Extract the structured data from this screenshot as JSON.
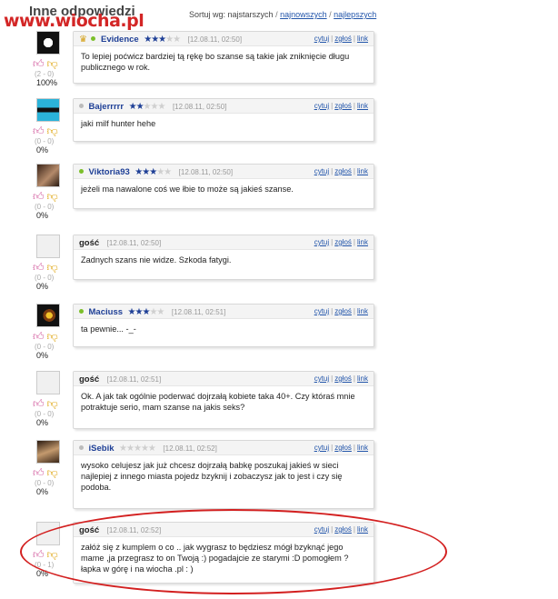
{
  "header": {
    "title": "Inne odpowiedzi",
    "watermark": "www.wiocha.pl",
    "sort_label": "Sortuj wg: najstarszych",
    "sort_separator": "/",
    "sort_newest": "najnowszych",
    "sort_best": "najlepszych"
  },
  "actions": {
    "quote": "cytuj",
    "report": "zgłoś",
    "link": "link",
    "sep": "|"
  },
  "comments": [
    {
      "user": "Evidence",
      "rating": 3,
      "date": "[12.08.11, 02:50]",
      "text": "To lepiej poćwicz bardziej tą rękę bo szanse są takie jak zniknięcie długu publicznego w rok.",
      "votes": "(2 - 0)",
      "percent": "100%",
      "status": "online"
    },
    {
      "user": "Bajerrrrr",
      "rating": 1.5,
      "date": "[12.08.11, 02:50]",
      "text": "jaki milf hunter hehe",
      "votes": "(0 - 0)",
      "percent": "0%",
      "status": "offline"
    },
    {
      "user": "Viktoria93",
      "rating": 3,
      "date": "[12.08.11, 02:50]",
      "text": "jeżeli ma nawalone coś we łbie to może są jakieś szanse.",
      "votes": "(0 - 0)",
      "percent": "0%",
      "status": "online"
    },
    {
      "user": "gość",
      "rating": 0,
      "date": "[12.08.11, 02:50]",
      "text": "Zadnych szans nie widze. Szkoda fatygi.",
      "votes": "(0 - 0)",
      "percent": "0%",
      "status": "guest"
    },
    {
      "user": "Maciuss",
      "rating": 3,
      "date": "[12.08.11, 02:51]",
      "text": "ta pewnie... -_-",
      "votes": "(0 - 0)",
      "percent": "0%",
      "status": "online"
    },
    {
      "user": "gość",
      "rating": 0,
      "date": "[12.08.11, 02:51]",
      "text": "Ok. A jak tak ogólnie poderwać dojrzałą kobiete taka 40+. Czy któraś mnie potraktuje serio, mam szanse na jakis seks?",
      "votes": "(0 - 0)",
      "percent": "0%",
      "status": "guest"
    },
    {
      "user": "iSebik",
      "rating": 0,
      "date": "[12.08.11, 02:52]",
      "text": "wysoko celujesz jak już chcesz dojrzałą babkę poszukaj jakieś w sieci najlepiej z innego miasta pojedz bzyknij i zobaczysz jak to jest i czy się podoba.",
      "votes": "(0 - 0)",
      "percent": "0%",
      "status": "offline"
    },
    {
      "user": "gość",
      "rating": 0,
      "date": "[12.08.11, 02:52]",
      "text": "załóż się z kumplem o co .. jak wygrasz to będziesz mógł bzyknąć jego mame ,ja przegrasz to on Twoją :) pogadajcie ze starymi :D pomogłem ? łapka w górę i na wiocha .pl : )",
      "votes": "(0 - 1)",
      "percent": "0%",
      "status": "guest"
    }
  ],
  "colors": {
    "username": "#1e3f96",
    "star_on": "#1e3f96",
    "star_off": "#cfcfcf",
    "online_dot": "#7bbf2a",
    "offline_dot": "#bbbbbb",
    "highlight": "#d32020",
    "watermark": "#d32626"
  },
  "icons": {
    "thumb_up": "thumb-up-icon",
    "thumb_down": "thumb-down-icon",
    "crown": "crown-icon",
    "star": "star-icon"
  }
}
